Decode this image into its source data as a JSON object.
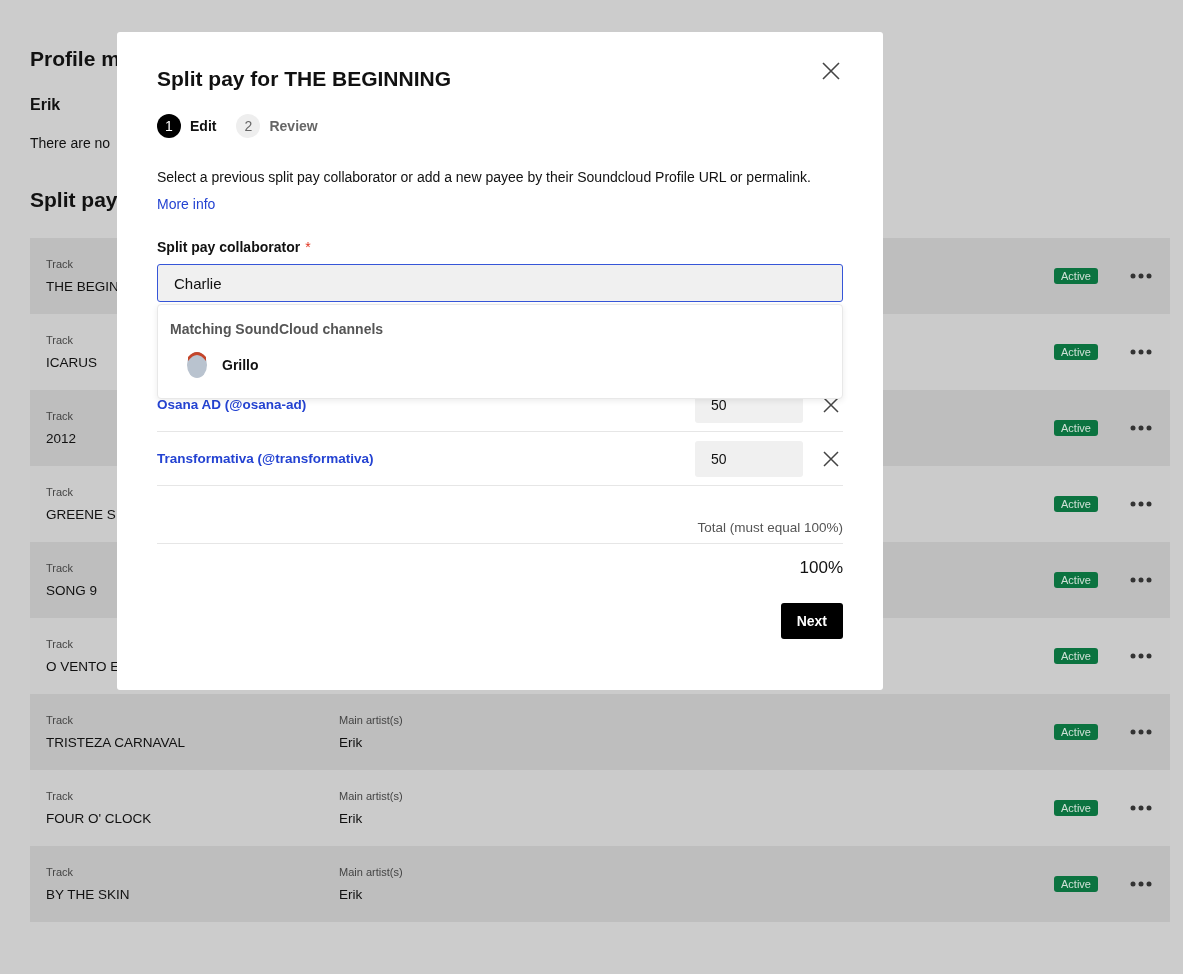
{
  "page": {
    "title": "Profile m",
    "artist_name": "Erik",
    "note": "There are no",
    "section_title": "Split pay"
  },
  "rows": [
    {
      "track_label": "Track",
      "track": "THE BEGIN",
      "status": "Active"
    },
    {
      "track_label": "Track",
      "track": "ICARUS",
      "status": "Active"
    },
    {
      "track_label": "Track",
      "track": "2012",
      "status": "Active"
    },
    {
      "track_label": "Track",
      "track": "GREENE S",
      "status": "Active"
    },
    {
      "track_label": "Track",
      "track": "SONG 9",
      "status": "Active"
    },
    {
      "track_label": "Track",
      "track": "O VENTO E",
      "status": "Active"
    },
    {
      "track_label": "Track",
      "track": "TRISTEZA CARNAVAL",
      "artist_label": "Main artist(s)",
      "artist": "Erik",
      "status": "Active"
    },
    {
      "track_label": "Track",
      "track": "FOUR O' CLOCK",
      "artist_label": "Main artist(s)",
      "artist": "Erik",
      "status": "Active"
    },
    {
      "track_label": "Track",
      "track": "BY THE SKIN",
      "artist_label": "Main artist(s)",
      "artist": "Erik",
      "status": "Active"
    }
  ],
  "dialog": {
    "title": "Split pay for THE BEGINNING",
    "steps": [
      {
        "number": "1",
        "label": "Edit",
        "selected": true
      },
      {
        "number": "2",
        "label": "Review",
        "selected": false
      }
    ],
    "description": "Select a previous split pay collaborator or add a new payee by their Soundcloud Profile URL or permalink.",
    "more_info": "More info",
    "field_label": "Split pay collaborator",
    "required_mark": "*",
    "field_value": "Charlie",
    "suggestions": {
      "heading": "Matching SoundCloud channels",
      "items": [
        {
          "name": "Grillo"
        }
      ]
    },
    "payees": [
      {
        "name": "Osana AD (@osana-ad)",
        "share": "50"
      },
      {
        "name": "Transformativa (@transformativa)",
        "share": "50"
      }
    ],
    "total_label": "Total (must equal 100%)",
    "total": "100%",
    "next": "Next"
  }
}
